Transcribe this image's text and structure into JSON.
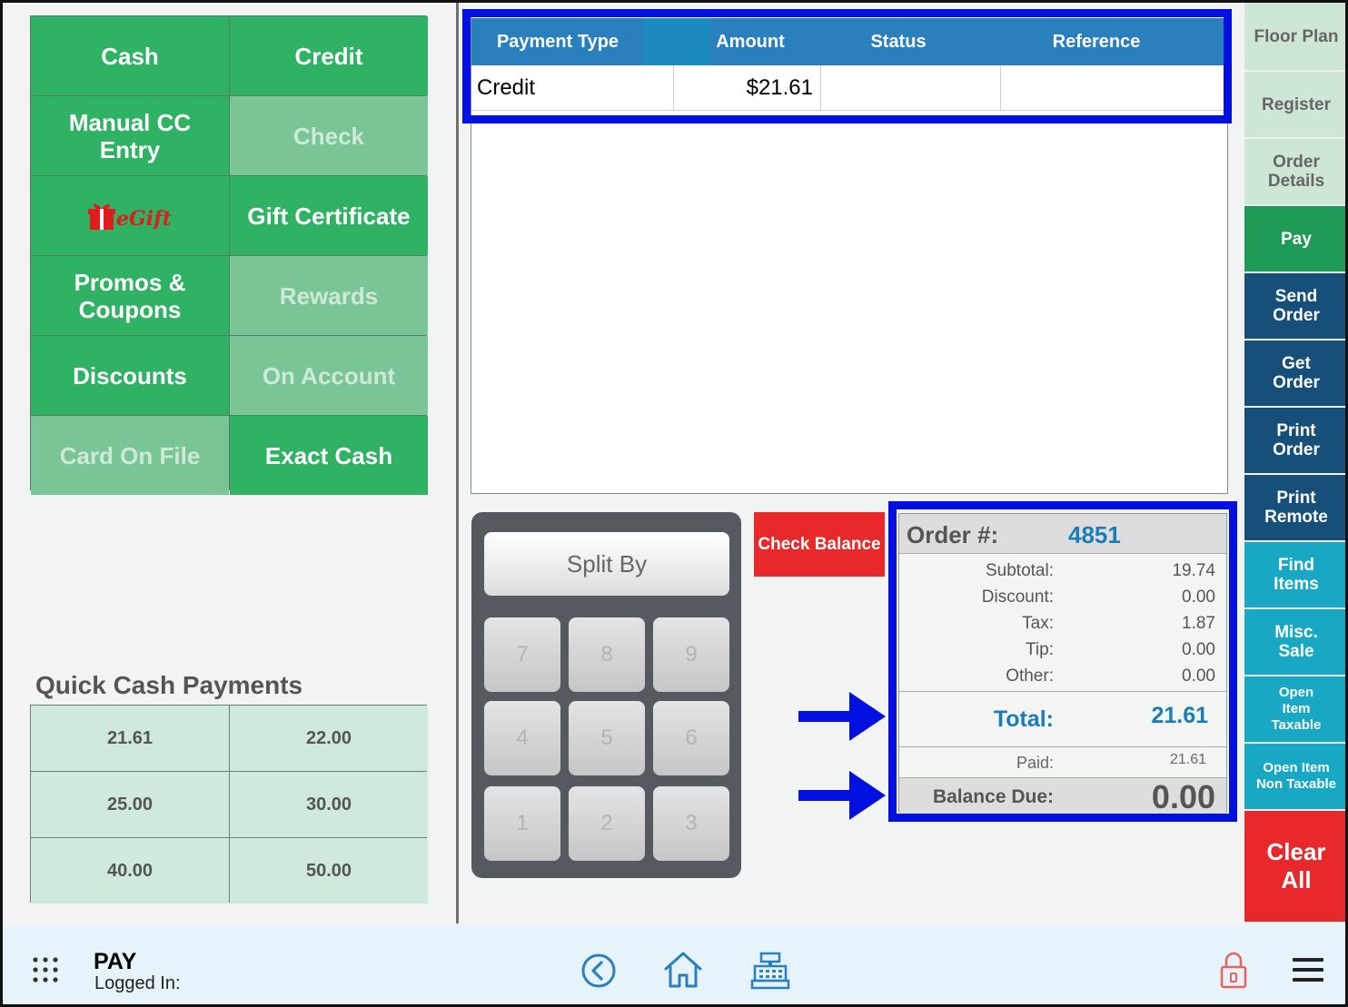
{
  "payment_methods": [
    {
      "label": "Cash",
      "enabled": true
    },
    {
      "label": "Credit",
      "enabled": true
    },
    {
      "label": "Manual CC Entry",
      "enabled": true
    },
    {
      "label": "Check",
      "enabled": false
    },
    {
      "label": "eGift",
      "enabled": true
    },
    {
      "label": "Gift Certificate",
      "enabled": true
    },
    {
      "label": "Promos & Coupons",
      "enabled": true
    },
    {
      "label": "Rewards",
      "enabled": false
    },
    {
      "label": "Discounts",
      "enabled": true
    },
    {
      "label": "On Account",
      "enabled": false
    },
    {
      "label": "Card On File",
      "enabled": false
    },
    {
      "label": "Exact Cash",
      "enabled": true
    }
  ],
  "quick_cash": {
    "title": "Quick Cash Payments",
    "amounts": [
      "21.61",
      "22.00",
      "25.00",
      "30.00",
      "40.00",
      "50.00"
    ]
  },
  "payments_table": {
    "columns": [
      "Payment Type",
      "Amount",
      "Status",
      "Reference"
    ],
    "rows": [
      {
        "type": "Credit",
        "amount": "$21.61",
        "status": "",
        "reference": ""
      }
    ]
  },
  "keypad": {
    "split_label": "Split By",
    "keys": [
      "7",
      "8",
      "9",
      "4",
      "5",
      "6",
      "1",
      "2",
      "3"
    ]
  },
  "check_balance_label": "Check Balance",
  "order_summary": {
    "order_label": "Order #:",
    "order_number": "4851",
    "lines": [
      {
        "label": "Subtotal:",
        "value": "19.74"
      },
      {
        "label": "Discount:",
        "value": "0.00"
      },
      {
        "label": "Tax:",
        "value": "1.87"
      },
      {
        "label": "Tip:",
        "value": "0.00"
      },
      {
        "label": "Other:",
        "value": "0.00"
      }
    ],
    "total_label": "Total:",
    "total_value": "21.61",
    "paid_label": "Paid:",
    "paid_value": "21.61",
    "balance_label": "Balance Due:",
    "balance_value": "0.00"
  },
  "sidebar": [
    {
      "label": "Floor Plan",
      "style": "light"
    },
    {
      "label": "Register",
      "style": "light"
    },
    {
      "label": "Order Details",
      "style": "light"
    },
    {
      "label": "Pay",
      "style": "green"
    },
    {
      "label": "Send Order",
      "style": "navy"
    },
    {
      "label": "Get Order",
      "style": "navy"
    },
    {
      "label": "Print Order",
      "style": "navy"
    },
    {
      "label": "Print Remote",
      "style": "navy"
    },
    {
      "label": "Find Items",
      "style": "teal"
    },
    {
      "label": "Misc. Sale",
      "style": "teal"
    },
    {
      "label": "Open Item Taxable",
      "style": "teal"
    },
    {
      "label": "Open Item Non Taxable",
      "style": "teal"
    },
    {
      "label": "Clear All",
      "style": "red"
    }
  ],
  "bottom_bar": {
    "screen_title": "PAY",
    "logged_in_label": "Logged In:",
    "icons": [
      "apps-grid-icon",
      "back-circle-icon",
      "home-icon",
      "cash-register-icon",
      "lock-icon",
      "hamburger-menu-icon"
    ]
  },
  "colors": {
    "payment_green": "#2fb264",
    "payment_disabled": "#79c596",
    "header_blue": "#2a7fbd",
    "highlight_blue": "#0010e0",
    "alert_red": "#e8282a",
    "navy": "#154f7a",
    "teal": "#18a8c4"
  }
}
